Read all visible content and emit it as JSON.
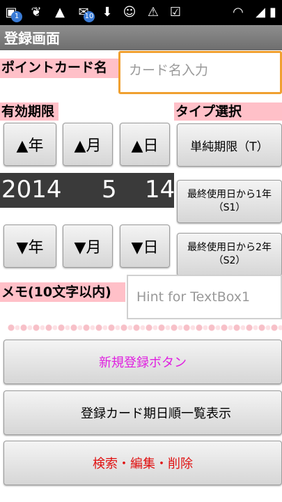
{
  "status_bar": {
    "notification_count_1": "1",
    "notification_count_2": "10",
    "time": ""
  },
  "title_bar": {
    "title": "登録画面"
  },
  "card_name": {
    "label": "ポイントカード名",
    "placeholder": "カード名入力"
  },
  "expiry": {
    "label": "有効期限",
    "year_up": "▲年",
    "month_up": "▲月",
    "day_up": "▲日",
    "year": "2014",
    "month": "5",
    "day": "14",
    "year_down": "▼年",
    "month_down": "▼月",
    "day_down": "▼日"
  },
  "type_select": {
    "label": "タイプ選択",
    "option_t": "単純期限（T）",
    "option_s1": "最終使用日から1年（S1）",
    "option_s2": "最終使用日から2年（S2）"
  },
  "memo": {
    "label": "メモ(10文字以内)",
    "hint": "Hint for TextBox1"
  },
  "actions": {
    "register": "新規登録ボタン",
    "register_color": "#e020e0",
    "list": "登録カード期日順一覧表示",
    "list_color": "#000000",
    "search": "検索・編集・削除",
    "search_color": "#e01010"
  },
  "colors": {
    "label_bg": "#ffc0c8",
    "focus_border": "#f0a030",
    "titlebar": "#7a7a7a",
    "date_bg": "#3a3a3a"
  }
}
